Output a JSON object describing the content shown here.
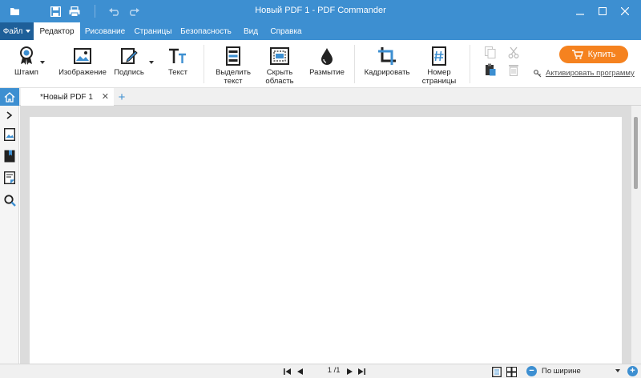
{
  "window": {
    "title": "Новый PDF 1 - PDF Commander"
  },
  "quick_access": [
    "open-folder-icon",
    "save-icon",
    "print-icon",
    "undo-icon",
    "redo-icon"
  ],
  "menu": {
    "file_label": "Файл",
    "tabs": [
      {
        "label": "Редактор",
        "active": true
      },
      {
        "label": "Рисование",
        "active": false
      },
      {
        "label": "Страницы",
        "active": false
      },
      {
        "label": "Безопасность",
        "active": false
      },
      {
        "label": "Вид",
        "active": false
      },
      {
        "label": "Справка",
        "active": false
      }
    ]
  },
  "ribbon": {
    "stamp": "Штамп",
    "image": "Изображение",
    "signature": "Подпись",
    "text": "Текст",
    "highlight_line1": "Выделить",
    "highlight_line2": "текст",
    "hide_line1": "Скрыть",
    "hide_line2": "область",
    "blur": "Размытие",
    "crop": "Кадрировать",
    "pagenum_line1": "Номер",
    "pagenum_line2": "страницы",
    "buy": "Купить",
    "activate": "Активировать программу"
  },
  "documents": {
    "tabs": [
      {
        "label": "*Новый PDF 1"
      }
    ]
  },
  "statusbar": {
    "current_page": "1",
    "total_pages": "/1",
    "zoom_mode": "По ширине"
  },
  "colors": {
    "accent": "#3d8fd1",
    "file_menu": "#1e5f99",
    "buy": "#f5821f"
  }
}
